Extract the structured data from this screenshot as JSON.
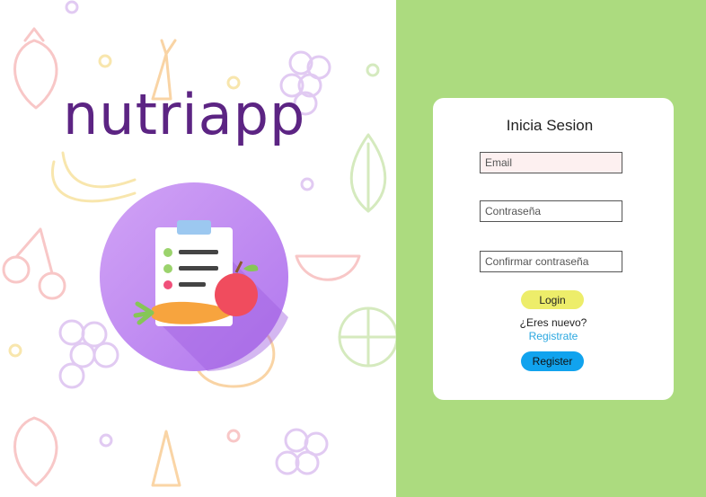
{
  "brand": {
    "name": "nutriapp"
  },
  "login_card": {
    "title": "Inicia Sesion",
    "email_placeholder": "Email",
    "password_placeholder": "Contraseña",
    "confirm_password_placeholder": "Confirmar contraseña",
    "login_label": "Login",
    "new_user_question": "¿Eres nuevo?",
    "register_link": "Registrate",
    "register_button": "Register"
  },
  "colors": {
    "right_background": "#acdb7f",
    "brand_purple": "#5c2483",
    "login_button": "#eded6a",
    "register_button": "#11a3ee",
    "link": "#2aa7e0"
  },
  "icons": [
    "clipboard-icon",
    "carrot-icon",
    "apple-icon",
    "fruit-pattern"
  ]
}
